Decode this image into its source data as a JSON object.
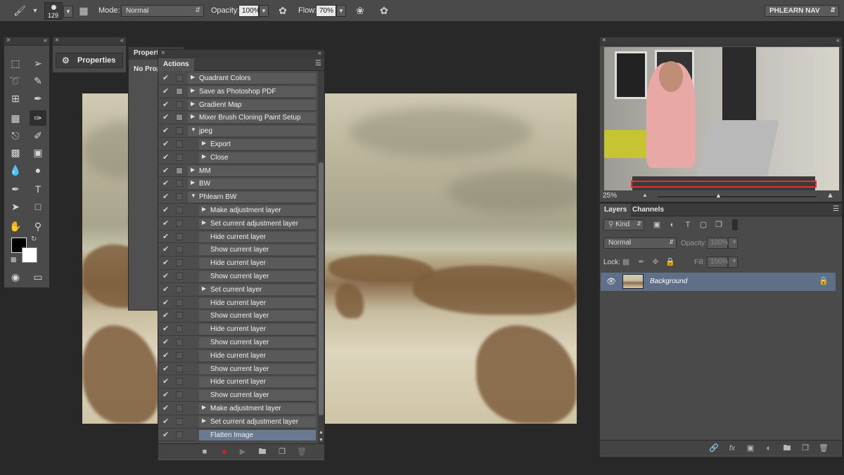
{
  "options_bar": {
    "brush_size": "129",
    "mode_label": "Mode:",
    "mode_value": "Normal",
    "opacity_label": "Opacity:",
    "opacity_value": "100%",
    "flow_label": "Flow:",
    "flow_value": "70%",
    "workspace": "PHLEARN NAV"
  },
  "properties_dock": {
    "label": "Properties"
  },
  "properties_panel": {
    "tab": "Properties",
    "text": "No Properties"
  },
  "actions_panel": {
    "tab": "Actions",
    "rows": [
      {
        "label": "Quadrant Colors",
        "level": 0,
        "expand": "collapsed",
        "dialog": false
      },
      {
        "label": "Save as Photoshop PDF",
        "level": 0,
        "expand": "collapsed",
        "dialog": true
      },
      {
        "label": "Gradient Map",
        "level": 0,
        "expand": "collapsed",
        "dialog": false
      },
      {
        "label": "Mixer Brush Cloning Paint Setup",
        "level": 0,
        "expand": "collapsed",
        "dialog": true
      },
      {
        "label": "jpeg",
        "level": 0,
        "expand": "expanded",
        "dialog": false
      },
      {
        "label": "Export",
        "level": 1,
        "expand": "collapsed",
        "dialog": false
      },
      {
        "label": "Close",
        "level": 1,
        "expand": "collapsed",
        "dialog": false
      },
      {
        "label": "MM",
        "level": 0,
        "expand": "collapsed",
        "dialog": true
      },
      {
        "label": "BW",
        "level": 0,
        "expand": "collapsed",
        "dialog": false
      },
      {
        "label": "Phlearn BW",
        "level": 0,
        "expand": "expanded",
        "dialog": false
      },
      {
        "label": "Make adjustment layer",
        "level": 1,
        "expand": "collapsed",
        "dialog": false
      },
      {
        "label": "Set current adjustment layer",
        "level": 1,
        "expand": "collapsed",
        "dialog": false
      },
      {
        "label": "Hide current layer",
        "level": 1,
        "expand": "none",
        "dialog": false
      },
      {
        "label": "Show current layer",
        "level": 1,
        "expand": "none",
        "dialog": false
      },
      {
        "label": "Hide current layer",
        "level": 1,
        "expand": "none",
        "dialog": false
      },
      {
        "label": "Show current layer",
        "level": 1,
        "expand": "none",
        "dialog": false
      },
      {
        "label": "Set current layer",
        "level": 1,
        "expand": "collapsed",
        "dialog": false
      },
      {
        "label": "Hide current layer",
        "level": 1,
        "expand": "none",
        "dialog": false
      },
      {
        "label": "Show current layer",
        "level": 1,
        "expand": "none",
        "dialog": false
      },
      {
        "label": "Hide current layer",
        "level": 1,
        "expand": "none",
        "dialog": false
      },
      {
        "label": "Show current layer",
        "level": 1,
        "expand": "none",
        "dialog": false
      },
      {
        "label": "Hide current layer",
        "level": 1,
        "expand": "none",
        "dialog": false
      },
      {
        "label": "Show current layer",
        "level": 1,
        "expand": "none",
        "dialog": false
      },
      {
        "label": "Hide current layer",
        "level": 1,
        "expand": "none",
        "dialog": false
      },
      {
        "label": "Show current layer",
        "level": 1,
        "expand": "none",
        "dialog": false
      },
      {
        "label": "Make adjustment layer",
        "level": 1,
        "expand": "collapsed",
        "dialog": false
      },
      {
        "label": "Set current adjustment layer",
        "level": 1,
        "expand": "collapsed",
        "dialog": false
      },
      {
        "label": "Flatten Image",
        "level": 1,
        "expand": "none",
        "dialog": false,
        "selected": true
      }
    ]
  },
  "navigator": {
    "zoom": "25%"
  },
  "layers_panel": {
    "tabs": [
      "Layers",
      "Channels"
    ],
    "kind_label": "Kind",
    "blend_mode": "Normal",
    "opacity_label": "Opacity:",
    "opacity_value": "100%",
    "lock_label": "Lock:",
    "fill_label": "Fill:",
    "fill_value": "100%",
    "layer_name": "Background"
  },
  "colors": {
    "panel_bg": "#4a4a4a",
    "app_bg": "#282828",
    "selection": "#5f6f88",
    "record": "#d0202a"
  }
}
